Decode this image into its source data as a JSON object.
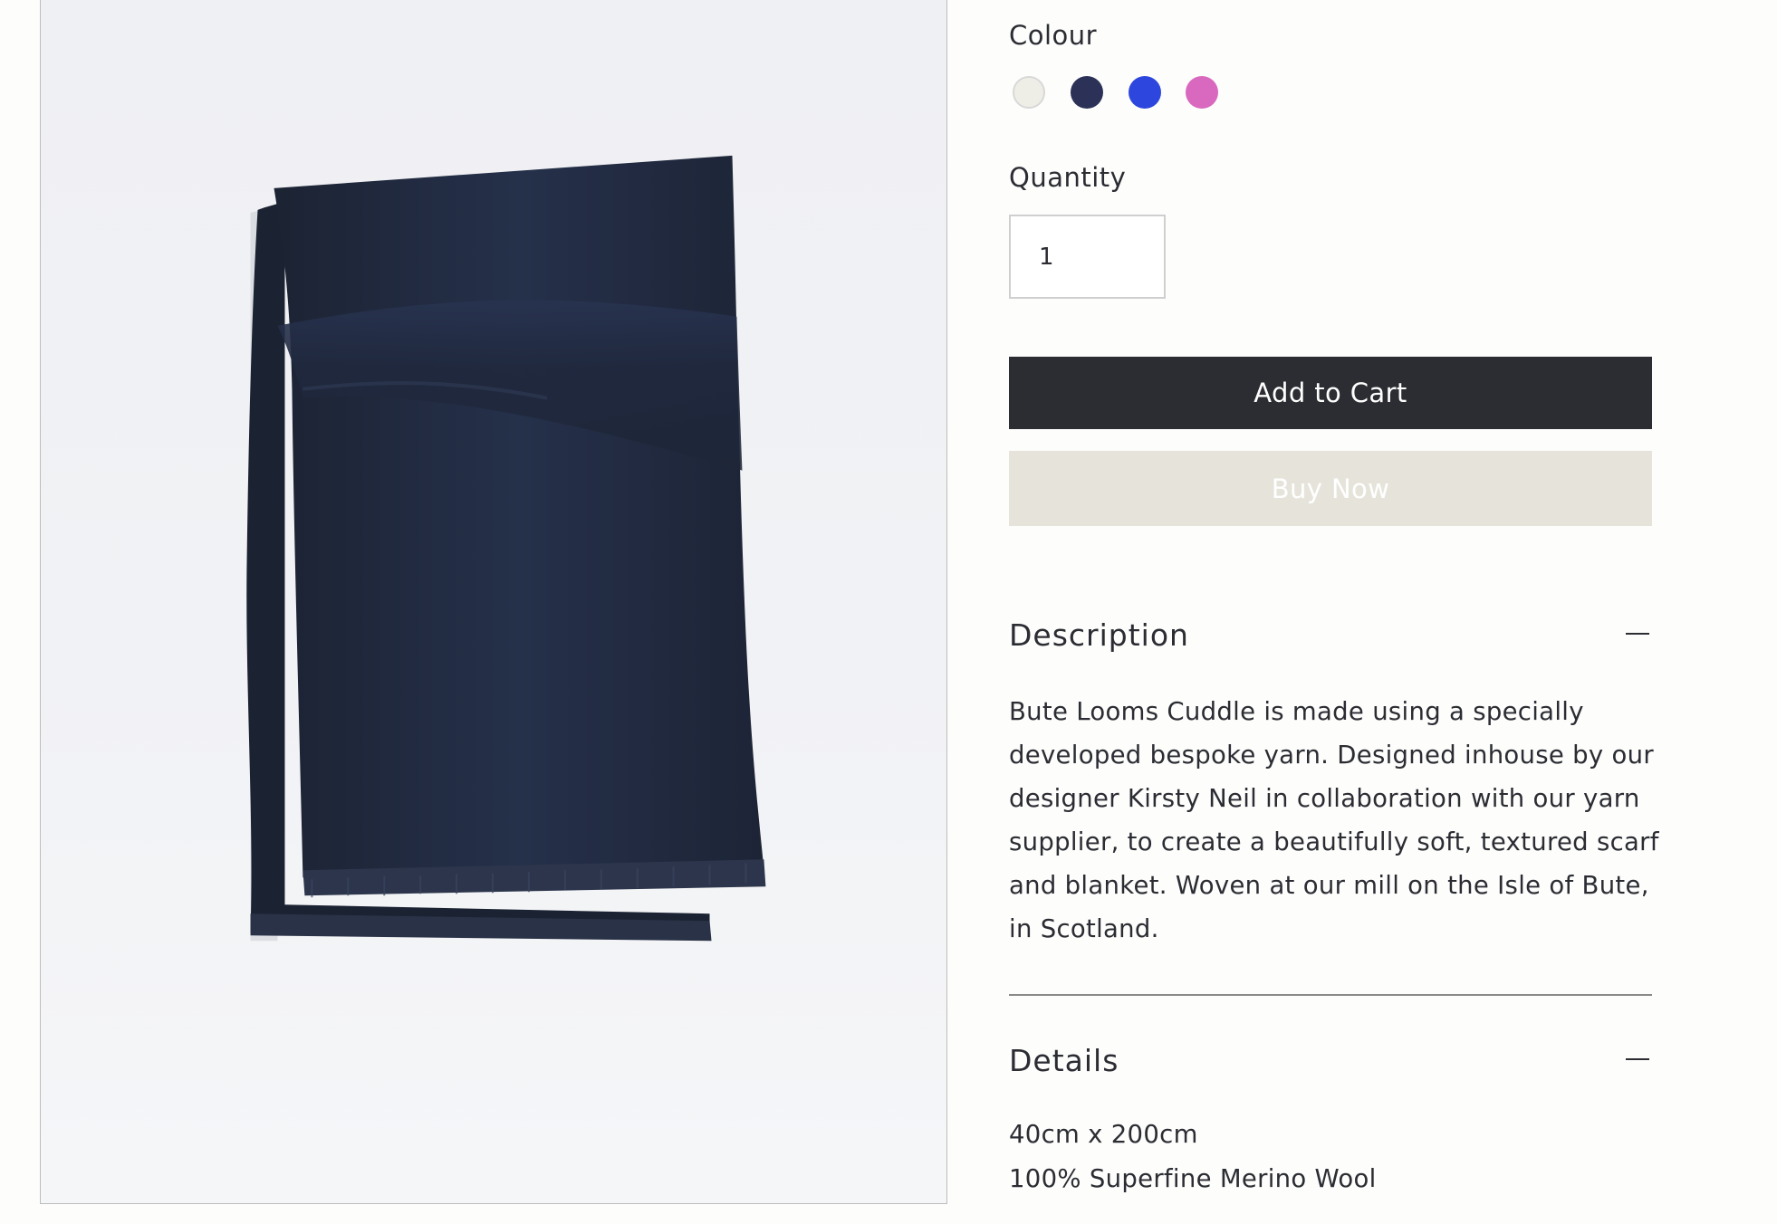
{
  "colour": {
    "label": "Colour",
    "swatches": [
      {
        "name": "cream",
        "color": "#efeee6"
      },
      {
        "name": "navy",
        "color": "#2c3257"
      },
      {
        "name": "blue",
        "color": "#2d46dd"
      },
      {
        "name": "pink",
        "color": "#d968bf"
      }
    ]
  },
  "quantity": {
    "label": "Quantity",
    "value": "1"
  },
  "buttons": {
    "add_to_cart": "Add to Cart",
    "buy_now": "Buy Now"
  },
  "description": {
    "title": "Description",
    "text": "Bute Looms Cuddle is made using a specially developed bespoke yarn. Designed inhouse by our designer Kirsty Neil in collaboration with our yarn supplier, to create a beautifully soft, textured scarf and blanket. Woven at our mill on the Isle of Bute, in Scotland."
  },
  "details": {
    "title": "Details",
    "lines": [
      "40cm x 200cm",
      "100% Superfine Merino Wool"
    ]
  },
  "colors": {
    "cart_button": "#2c2d33",
    "buy_button": "#e6e4da",
    "scarf": "#222a3a"
  }
}
